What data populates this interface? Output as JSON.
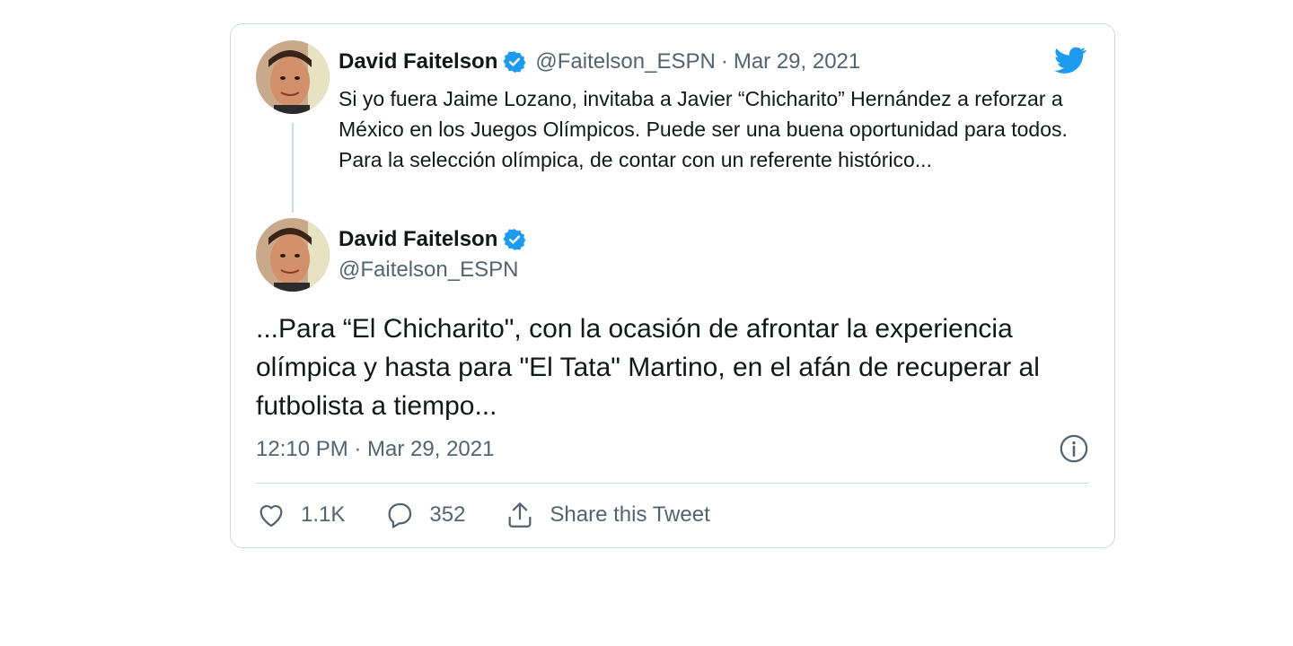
{
  "quoted_tweet": {
    "author_name": "David Faitelson",
    "handle": "@Faitelson_ESPN",
    "separator": "·",
    "date": "Mar 29, 2021",
    "text": "Si yo fuera Jaime Lozano, invitaba a Javier “Chicharito” Hernández a reforzar a México en los Juegos Olímpicos. Puede ser una buena oportunidad para todos. Para la selección olímpica, de contar con un referente histórico..."
  },
  "tweet": {
    "author_name": "David Faitelson",
    "handle": "@Faitelson_ESPN",
    "text": "...Para “El Chicharito\", con la ocasión  de afrontar la experiencia olímpica y hasta para \"El Tata\" Martino, en el afán de recuperar al futbolista a tiempo...",
    "timestamp": "12:10 PM · Mar 29, 2021"
  },
  "actions": {
    "likes": "1.1K",
    "replies": "352",
    "share_label": "Share this Tweet"
  },
  "icons": {
    "brand": "twitter-bird-icon",
    "verified": "verified-badge-icon",
    "info": "info-icon",
    "like": "heart-icon",
    "reply": "comment-icon",
    "share": "share-icon"
  },
  "colors": {
    "brand": "#1d9bf0",
    "verified": "#1d9bf0",
    "secondary_text": "#536471",
    "border": "#cfd9de"
  }
}
